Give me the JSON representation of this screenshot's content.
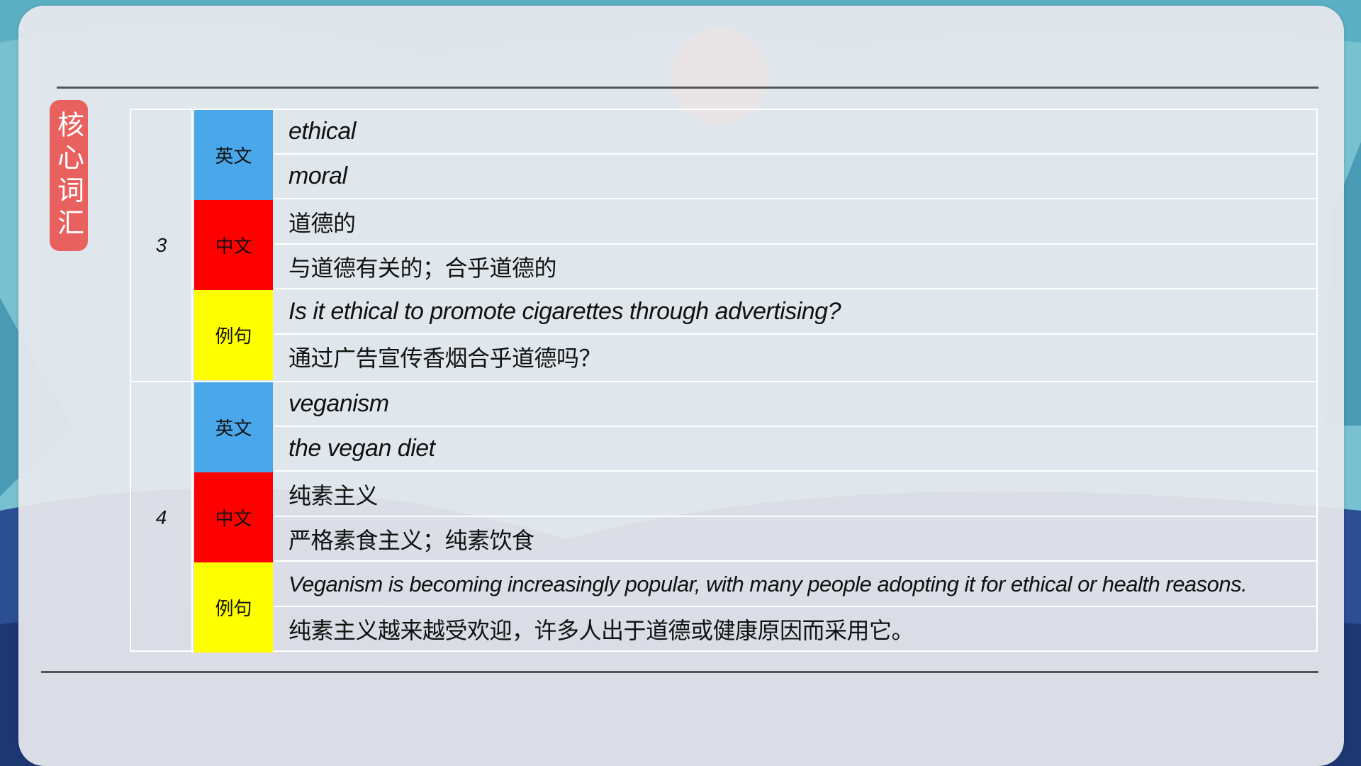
{
  "page": {
    "badge_label": "核心词汇",
    "colors": {
      "badge": "#e8615f",
      "english": "#4aa7ea",
      "chinese": "#ff0000",
      "example": "#ffff00"
    }
  },
  "vocab": [
    {
      "number": "3",
      "english_label": "英文",
      "english": [
        "ethical",
        "moral"
      ],
      "chinese_label": "中文",
      "chinese": [
        "道德的",
        "与道德有关的；合乎道德的"
      ],
      "example_label": "例句",
      "example": [
        "Is it ethical to promote cigarettes through advertising?",
        "通过广告宣传香烟合乎道德吗？"
      ]
    },
    {
      "number": "4",
      "english_label": "英文",
      "english": [
        "veganism",
        "the vegan diet"
      ],
      "chinese_label": "中文",
      "chinese": [
        "纯素主义",
        "严格素食主义；纯素饮食"
      ],
      "example_label": "例句",
      "example": [
        "Veganism is becoming increasingly popular, with many people adopting it for ethical or health reasons.",
        "纯素主义越来越受欢迎，许多人出于道德或健康原因而采用它。"
      ]
    }
  ]
}
